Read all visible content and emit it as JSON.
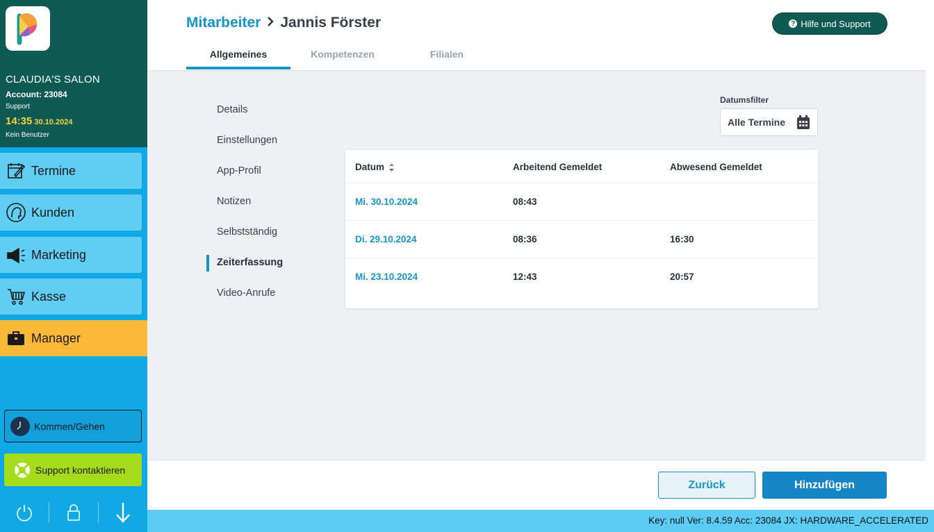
{
  "sidebar": {
    "salon_name": "CLAUDIA'S SALON",
    "account": "Account: 23084",
    "role": "Support",
    "time": "14:35",
    "date": "30.10.2024",
    "user": "Kein Benutzer",
    "nav": [
      {
        "label": "Termine",
        "icon": "calendar-edit-icon"
      },
      {
        "label": "Kunden",
        "icon": "customer-head-icon"
      },
      {
        "label": "Marketing",
        "icon": "megaphone-icon"
      },
      {
        "label": "Kasse",
        "icon": "cart-icon"
      },
      {
        "label": "Manager",
        "icon": "briefcase-icon",
        "active": true
      }
    ],
    "clock_button": "Kommen/Gehen",
    "support_button": "Support kontaktieren",
    "bottom_icons": [
      "power-icon",
      "lock-icon",
      "arrow-down-icon"
    ]
  },
  "header": {
    "crumb_parent": "Mitarbeiter",
    "crumb_current": "Jannis Förster",
    "help_button": "Hilfe und Support",
    "tabs": [
      "Allgemeines",
      "Kompetenzen",
      "Filialen"
    ],
    "active_tab": "Allgemeines"
  },
  "subnav": {
    "items": [
      "Details",
      "Einstellungen",
      "App-Profil",
      "Notizen",
      "Selbstständig",
      "Zeiterfassung",
      "Video-Anrufe"
    ],
    "active": "Zeiterfassung"
  },
  "filter": {
    "label": "Datumsfilter",
    "value": "Alle Termine"
  },
  "table": {
    "columns": [
      "Datum",
      "Arbeitend Gemeldet",
      "Abwesend Gemeldet"
    ],
    "rows": [
      {
        "date": "Mi. 30.10.2024",
        "working": "08:43",
        "absent": ""
      },
      {
        "date": "Di. 29.10.2024",
        "working": "08:36",
        "absent": "16:30"
      },
      {
        "date": "Mi. 23.10.2024",
        "working": "12:43",
        "absent": "20:57"
      }
    ]
  },
  "footer": {
    "back": "Zurück",
    "add": "Hinzufügen"
  },
  "status": "Key: null Ver: 8.4.59 Acc: 23084  JX: HARDWARE_ACCELERATED",
  "colors": {
    "brand_dark": "#0f5a52",
    "sidebar_blue": "#11a8e6",
    "accent_blue": "#1595c8",
    "manager_orange": "#fbb93a",
    "support_green": "#a4dc1a"
  }
}
